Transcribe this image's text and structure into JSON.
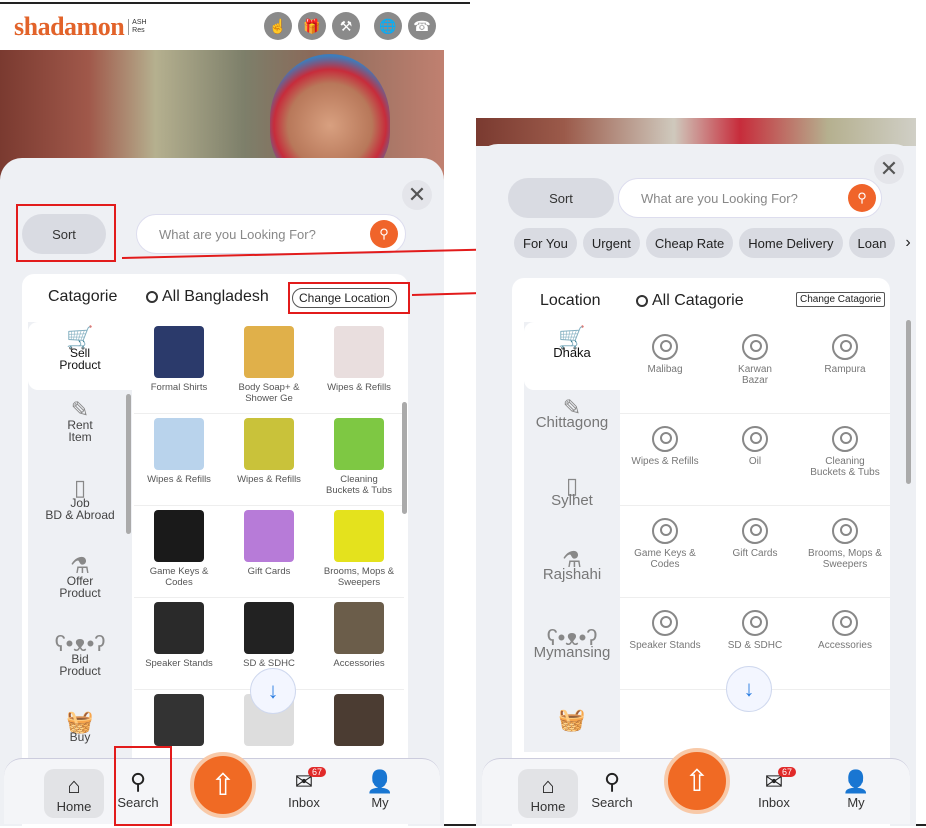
{
  "left": {
    "logo": "shadamon",
    "logo_sub": "ASH\nRes",
    "header_icons": [
      "touch-icon",
      "gift-icon",
      "auction-icon",
      "globe-icon",
      "phone-icon"
    ],
    "sort_label": "Sort",
    "search_placeholder": "What are you Looking For?",
    "tab_category": "Catagorie",
    "location_label": "All Bangladesh",
    "change_location": "Change Location",
    "sidebar": [
      {
        "icon": "cart-icon",
        "label": "Sell\nProduct"
      },
      {
        "icon": "pen-icon",
        "label": "Rent\nItem"
      },
      {
        "icon": "briefcase-icon",
        "label": "Job\nBD & Abroad"
      },
      {
        "icon": "bottle-icon",
        "label": "Offer\nProduct"
      },
      {
        "icon": "teddy-icon",
        "label": "Bid\nProduct"
      },
      {
        "icon": "basket-icon",
        "label": "Buy"
      }
    ],
    "products": [
      {
        "label": "Formal Shirts",
        "color": "#2b3a6b"
      },
      {
        "label": "Body Soap+ &\nShower Ge",
        "color": "#e0b04a"
      },
      {
        "label": "Wipes & Refills",
        "color": "#e9dede"
      },
      {
        "label": "Wipes & Refills",
        "color": "#b9d3ec"
      },
      {
        "label": "Wipes & Refills",
        "color": "#c9c23a"
      },
      {
        "label": "Cleaning\nBuckets & Tubs",
        "color": "#7ec843"
      },
      {
        "label": "Game Keys &\nCodes",
        "color": "#1a1a1a"
      },
      {
        "label": "Gift Cards",
        "color": "#b77bd8"
      },
      {
        "label": "Brooms, Mops &\nSweepers",
        "color": "#e4e21d"
      },
      {
        "label": "Speaker Stands",
        "color": "#2a2a2a"
      },
      {
        "label": "SD & SDHC",
        "color": "#222222"
      },
      {
        "label": "Accessories",
        "color": "#6b5d4a"
      },
      {
        "label": "",
        "color": "#333333"
      },
      {
        "label": "",
        "color": "#dddddd"
      },
      {
        "label": "",
        "color": "#4b3c32"
      }
    ],
    "nav": {
      "home": "Home",
      "search": "Search",
      "inbox": "Inbox",
      "my": "My",
      "badge": "67"
    }
  },
  "right": {
    "sort_label": "Sort",
    "search_placeholder": "What are you Looking For?",
    "chips": [
      "For You",
      "Urgent",
      "Cheap Rate",
      "Home Delivery",
      "Loan"
    ],
    "tab_location": "Location",
    "category_label": "All Catagorie",
    "change_category": "Change Catagorie",
    "sidebar": [
      {
        "icon": "cart-icon",
        "label": "Dhaka"
      },
      {
        "icon": "pen-icon",
        "label": "Chittagong"
      },
      {
        "icon": "briefcase-icon",
        "label": "Sylhet"
      },
      {
        "icon": "bottle-icon",
        "label": "Rajshahi"
      },
      {
        "icon": "teddy-icon",
        "label": "Mymansing"
      },
      {
        "icon": "basket-icon",
        "label": ""
      }
    ],
    "areas": [
      "Malibag",
      "Karwan\nBazar",
      "Rampura",
      "Wipes & Refills",
      "Oil",
      "Cleaning\nBuckets & Tubs",
      "Game Keys &\nCodes",
      "Gift Cards",
      "Brooms, Mops &\nSweepers",
      "Speaker Stands",
      "SD & SDHC",
      "Accessories"
    ],
    "nav": {
      "home": "Home",
      "search": "Search",
      "inbox": "Inbox",
      "my": "My",
      "badge": "67"
    }
  },
  "colors": {
    "accent": "#f0642a",
    "annotation": "#e21b1b",
    "scroll": "#2a7de1"
  }
}
